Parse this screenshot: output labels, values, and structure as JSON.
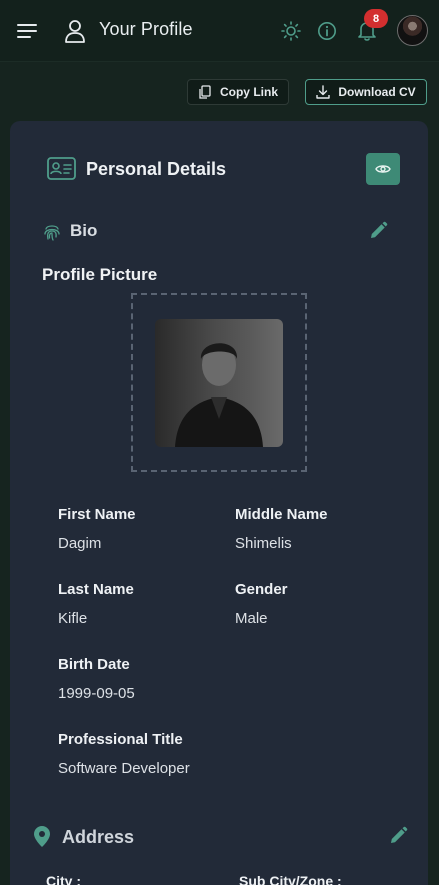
{
  "header": {
    "title": "Your Profile",
    "notification_count": "8",
    "icons": [
      "menu-icon",
      "user-icon",
      "sun-icon",
      "info-icon",
      "bell-icon"
    ]
  },
  "actions": {
    "copy_link": "Copy Link",
    "download_cv": "Download CV"
  },
  "personal_details": {
    "title": "Personal Details",
    "bio_title": "Bio",
    "profile_picture_label": "Profile Picture",
    "fields": [
      {
        "label": "First Name",
        "value": "Dagim"
      },
      {
        "label": "Middle Name",
        "value": "Shimelis"
      },
      {
        "label": "Last Name",
        "value": "Kifle"
      },
      {
        "label": "Gender",
        "value": "Male"
      },
      {
        "label": "Birth Date",
        "value": "1999-09-05"
      },
      {
        "label": "Professional Title",
        "value": "Software Developer"
      }
    ]
  },
  "address": {
    "title": "Address",
    "city_label": "City :",
    "subcity_label": "Sub City/Zone :"
  },
  "colors": {
    "accent": "#3e8a76",
    "accent_icon": "#4f9d8a",
    "badge": "#d32f2f",
    "card_bg": "#222a38",
    "page_bg": "#16241f"
  }
}
